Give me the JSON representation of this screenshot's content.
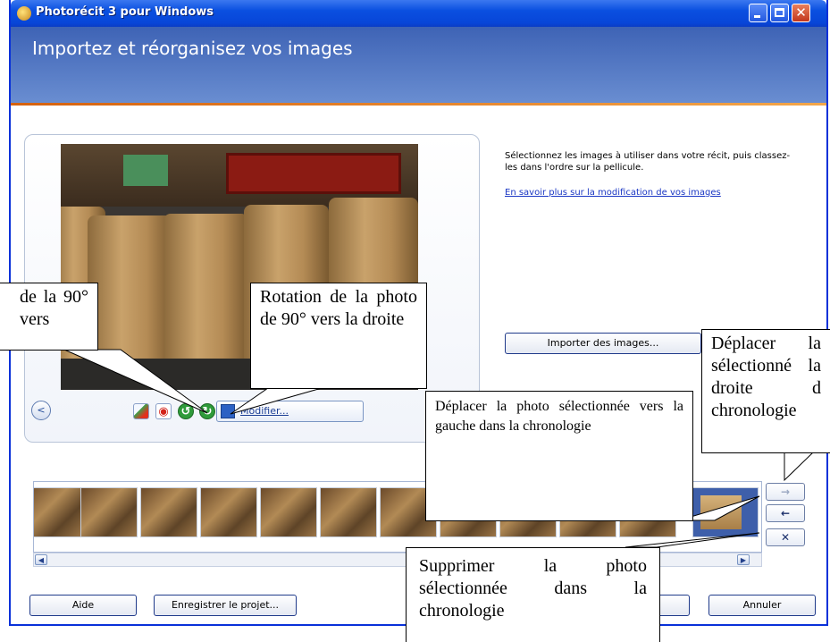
{
  "window": {
    "title": "Photorécit 3 pour Windows",
    "close_glyph": "✕"
  },
  "header": {
    "title": "Importez et réorganisez vos images"
  },
  "preview": {
    "nav_back_glyph": "<",
    "modify_label": "Modifier..."
  },
  "instructions": {
    "text": "Sélectionnez les images à utiliser dans votre récit, puis classez-les dans l'ordre sur la pellicule.",
    "link": "En savoir plus sur la modification de vos images"
  },
  "import_button": "Importer des images...",
  "side_buttons": {
    "right_glyph": "→",
    "left_glyph": "←",
    "remove_glyph": "✕"
  },
  "bottom_buttons": {
    "help": "Aide",
    "save_project": "Enregistrer le projet...",
    "cancel": "Annuler"
  },
  "callouts": {
    "rotate_left": "de la 90° vers",
    "rotate_right": "Rotation de la photo de 90° vers la droite",
    "move_right": "Déplacer la sélectionné la droite d chronologie",
    "move_left": "Déplacer la photo sélectionnée vers la gauche dans la chronologie",
    "delete": "Supprimer la photo sélectionnée dans la chronologie"
  },
  "colors": {
    "titlebar": "#0a4fe0",
    "header": "#3e63b5",
    "accent_line": "#d5620f",
    "link": "#1b37c4"
  },
  "icons": [
    "app-icon",
    "minimize-icon",
    "maximize-icon",
    "close-icon",
    "back-arrow-icon",
    "auto-correct-icon",
    "red-eye-icon",
    "rotate-left-icon",
    "rotate-right-icon",
    "edit-icon",
    "move-right-icon",
    "move-left-icon",
    "remove-icon"
  ]
}
